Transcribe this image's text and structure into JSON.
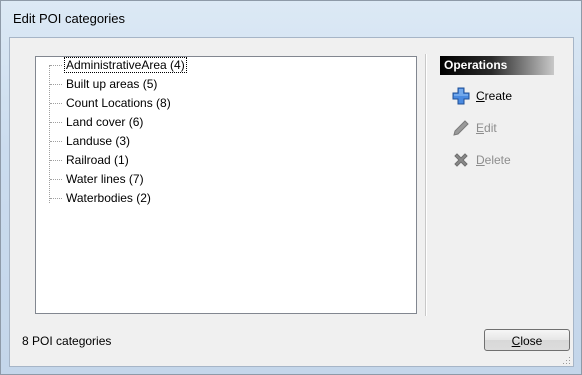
{
  "window": {
    "title": "Edit POI categories"
  },
  "tree": {
    "items": [
      {
        "label": "AdministrativeArea (4)",
        "selected": true
      },
      {
        "label": "Built up areas (5)"
      },
      {
        "label": "Count Locations (8)"
      },
      {
        "label": "Land cover (6)"
      },
      {
        "label": "Landuse (3)"
      },
      {
        "label": "Railroad (1)"
      },
      {
        "label": "Water lines (7)"
      },
      {
        "label": "Waterbodies (2)"
      }
    ]
  },
  "operations": {
    "header": "Operations",
    "create": {
      "label": "Create",
      "icon": "plus-icon",
      "enabled": true
    },
    "edit": {
      "label": "Edit",
      "icon": "pencil-icon",
      "enabled": false
    },
    "delete": {
      "label": "Delete",
      "icon": "x-icon",
      "enabled": false
    }
  },
  "status": {
    "text": "8 POI categories"
  },
  "close_button": {
    "label": "Close"
  },
  "colors": {
    "plus_blue": "#3f7fd6",
    "disabled_gray": "#8d8d8d"
  }
}
